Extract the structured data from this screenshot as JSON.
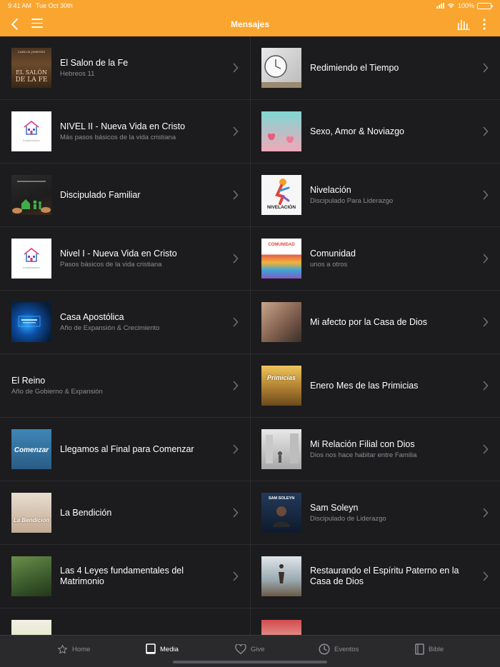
{
  "status_bar": {
    "time": "9:41 AM",
    "date": "Tue Oct 30th",
    "battery": "100%",
    "battery_level": 1.0
  },
  "nav": {
    "title": "Mensajes",
    "back_icon": "chevron-left-icon",
    "menu_icon": "hamburger-icon",
    "audio_icon": "audio-bars-icon",
    "more_icon": "more-vertical-icon"
  },
  "colors": {
    "header": "#f9a52f",
    "background": "#1c1c1e",
    "subtitle": "#8e8e93",
    "divider": "#2c2c2e",
    "tabbar": "#2a2a2c"
  },
  "thumbnail_text": {
    "salon_top": "CARLOS JIMENEZ",
    "salon_line1": "EL SALÓN",
    "salon_line2": "DE LA FE",
    "fundamentos": "fundamentos",
    "nivelacion": "NIVELACIÓN",
    "comunidad": "COMUNIDAD",
    "primicias": "Primicias",
    "comenzar": "Comenzar",
    "bendicion": "La Bendición",
    "sam": "SAM SOLEYN"
  },
  "left_column": [
    {
      "title": "El Salon de la Fe",
      "subtitle": "Hebreos 11",
      "thumb": "salon"
    },
    {
      "title": "NIVEL II - Nueva Vida en Cristo",
      "subtitle": "Más pasos básicos de la vida cristiana",
      "thumb": "house"
    },
    {
      "title": "Discipulado Familiar",
      "subtitle": "",
      "thumb": "family"
    },
    {
      "title": "Nivel I - Nueva Vida en Cristo",
      "subtitle": "Pasos básicos de la vida cristiana",
      "thumb": "house"
    },
    {
      "title": "Casa Apostólica",
      "subtitle": "Año de Expansión & Crecimiento",
      "thumb": "casa"
    },
    {
      "title": "El Reino",
      "subtitle": "Año de Gobierno & Expansión",
      "thumb": ""
    },
    {
      "title": "Llegamos al Final para Comenzar",
      "subtitle": "",
      "thumb": "final"
    },
    {
      "title": "La Bendición",
      "subtitle": "",
      "thumb": "bendicion"
    },
    {
      "title": "Las 4 Leyes fundamentales del Matrimonio",
      "subtitle": "",
      "thumb": "leyes"
    }
  ],
  "right_column": [
    {
      "title": "Redimiendo el Tiempo",
      "subtitle": "",
      "thumb": "reloj"
    },
    {
      "title": "Sexo, Amor & Noviazgo",
      "subtitle": "",
      "thumb": "sexo"
    },
    {
      "title": "Nivelación",
      "subtitle": "Discipulado Para Liderazgo",
      "thumb": "nivelacion"
    },
    {
      "title": "Comunidad",
      "subtitle": "unos a otros",
      "thumb": "comunidad"
    },
    {
      "title": "Mi afecto por la Casa de Dios",
      "subtitle": "",
      "thumb": "afecto"
    },
    {
      "title": "Enero Mes de las Primicias",
      "subtitle": "",
      "thumb": "primicias"
    },
    {
      "title": "Mi Relación Filial con Dios",
      "subtitle": "Dios nos hace habitar entre Familia",
      "thumb": "filial"
    },
    {
      "title": "Sam Soleyn",
      "subtitle": "Discipulado de Liderazgo",
      "thumb": "sam"
    },
    {
      "title": "Restaurando el Espíritu Paterno en la Casa de Dios",
      "subtitle": "",
      "thumb": "paterno"
    }
  ],
  "tabs": [
    {
      "label": "Home",
      "icon": "star-icon",
      "active": false
    },
    {
      "label": "Media",
      "icon": "book-icon",
      "active": true
    },
    {
      "label": "Give",
      "icon": "heart-icon",
      "active": false
    },
    {
      "label": "Eventos",
      "icon": "clock-icon",
      "active": false
    },
    {
      "label": "Bible",
      "icon": "bible-icon",
      "active": false
    }
  ]
}
